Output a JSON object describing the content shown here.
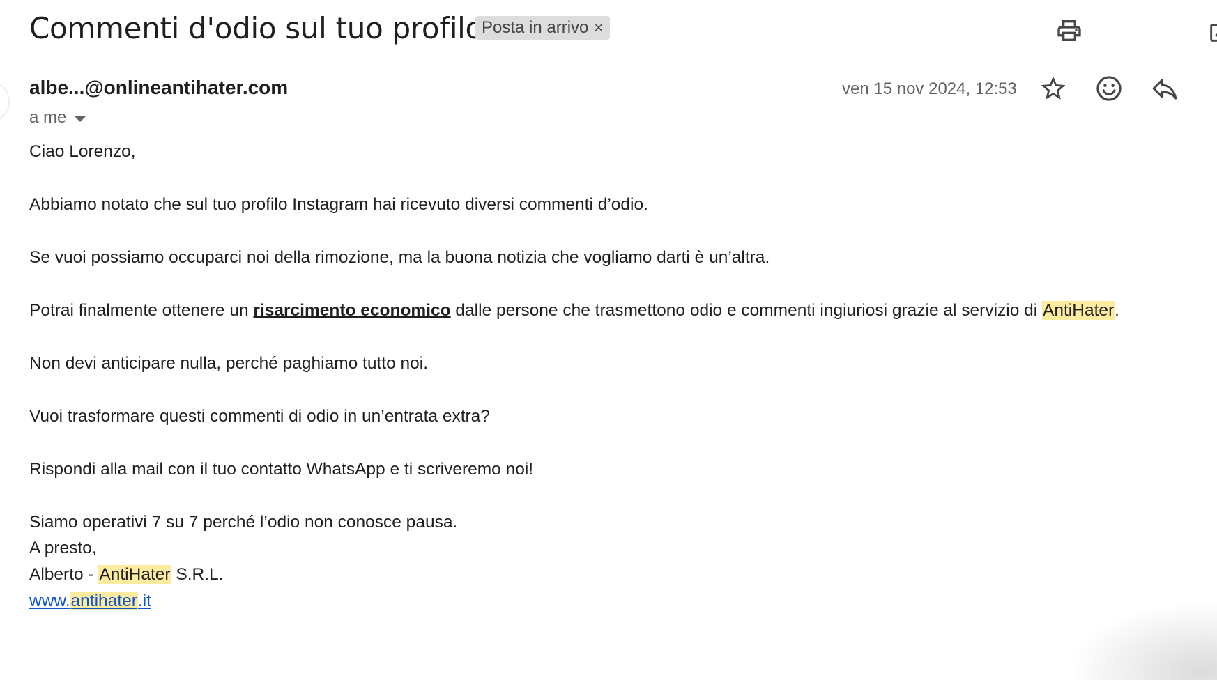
{
  "email": {
    "subject": "Commenti d'odio sul tuo profilo",
    "label": "Posta in arrivo",
    "label_remove": "×",
    "sender": "albe...@onlineantihater.com",
    "recipient": "a me",
    "date": "ven 15 nov 2024, 12:53"
  },
  "icons": {
    "print": "print-icon",
    "open_new_window": "open-in-new-icon",
    "star": "star-outline-icon",
    "emoji": "emoji-reaction-icon",
    "reply": "reply-icon",
    "dropdown": "caret-down-icon"
  },
  "body": {
    "greeting": "Ciao Lorenzo,",
    "p1": "Abbiamo notato che sul tuo profilo Instagram hai ricevuto diversi commenti d’odio.",
    "p2": "Se vuoi possiamo occuparci noi della rimozione, ma la buona notizia che vogliamo darti è un’altra.",
    "p3_before": "Potrai finalmente ottenere un ",
    "p3_link": "risarcimento economico",
    "p3_middle": " dalle persone che trasmettono odio e commenti ingiuriosi grazie al servizio di ",
    "p3_brand": "AntiHater",
    "p3_end": ".",
    "p4": "Non devi anticipare nulla, perché paghiamo tutto noi.",
    "p5": "Vuoi trasformare questi commenti di odio in un’entrata extra?",
    "p6": "Rispondi alla mail con il tuo contatto WhatsApp e ti scriveremo noi!",
    "p7": "Siamo operativi 7 su 7 perché l’odio non conosce pausa.",
    "closing": "A presto,",
    "sig_name": "Alberto - ",
    "sig_brand": "AntiHater",
    "sig_company": " S.R.L.",
    "site_prefix": "www.",
    "site_brand": "antihater",
    "site_suffix": ".it"
  },
  "colors": {
    "highlight": "#fdeba0",
    "link": "#1155cc",
    "label_chip": "#dddddd",
    "secondary_text": "#5f6368"
  }
}
